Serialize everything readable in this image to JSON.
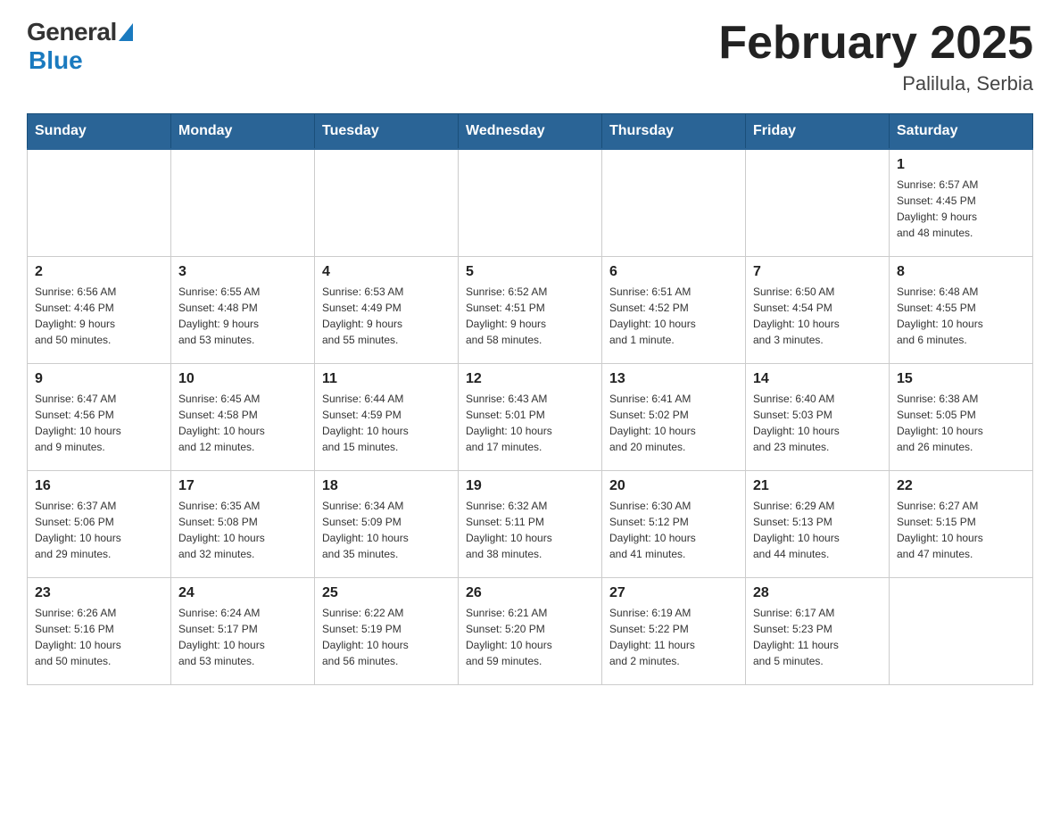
{
  "header": {
    "logo": {
      "general": "General",
      "blue": "Blue"
    },
    "title": "February 2025",
    "location": "Palilula, Serbia"
  },
  "weekdays": [
    "Sunday",
    "Monday",
    "Tuesday",
    "Wednesday",
    "Thursday",
    "Friday",
    "Saturday"
  ],
  "weeks": [
    [
      {
        "day": "",
        "info": ""
      },
      {
        "day": "",
        "info": ""
      },
      {
        "day": "",
        "info": ""
      },
      {
        "day": "",
        "info": ""
      },
      {
        "day": "",
        "info": ""
      },
      {
        "day": "",
        "info": ""
      },
      {
        "day": "1",
        "info": "Sunrise: 6:57 AM\nSunset: 4:45 PM\nDaylight: 9 hours\nand 48 minutes."
      }
    ],
    [
      {
        "day": "2",
        "info": "Sunrise: 6:56 AM\nSunset: 4:46 PM\nDaylight: 9 hours\nand 50 minutes."
      },
      {
        "day": "3",
        "info": "Sunrise: 6:55 AM\nSunset: 4:48 PM\nDaylight: 9 hours\nand 53 minutes."
      },
      {
        "day": "4",
        "info": "Sunrise: 6:53 AM\nSunset: 4:49 PM\nDaylight: 9 hours\nand 55 minutes."
      },
      {
        "day": "5",
        "info": "Sunrise: 6:52 AM\nSunset: 4:51 PM\nDaylight: 9 hours\nand 58 minutes."
      },
      {
        "day": "6",
        "info": "Sunrise: 6:51 AM\nSunset: 4:52 PM\nDaylight: 10 hours\nand 1 minute."
      },
      {
        "day": "7",
        "info": "Sunrise: 6:50 AM\nSunset: 4:54 PM\nDaylight: 10 hours\nand 3 minutes."
      },
      {
        "day": "8",
        "info": "Sunrise: 6:48 AM\nSunset: 4:55 PM\nDaylight: 10 hours\nand 6 minutes."
      }
    ],
    [
      {
        "day": "9",
        "info": "Sunrise: 6:47 AM\nSunset: 4:56 PM\nDaylight: 10 hours\nand 9 minutes."
      },
      {
        "day": "10",
        "info": "Sunrise: 6:45 AM\nSunset: 4:58 PM\nDaylight: 10 hours\nand 12 minutes."
      },
      {
        "day": "11",
        "info": "Sunrise: 6:44 AM\nSunset: 4:59 PM\nDaylight: 10 hours\nand 15 minutes."
      },
      {
        "day": "12",
        "info": "Sunrise: 6:43 AM\nSunset: 5:01 PM\nDaylight: 10 hours\nand 17 minutes."
      },
      {
        "day": "13",
        "info": "Sunrise: 6:41 AM\nSunset: 5:02 PM\nDaylight: 10 hours\nand 20 minutes."
      },
      {
        "day": "14",
        "info": "Sunrise: 6:40 AM\nSunset: 5:03 PM\nDaylight: 10 hours\nand 23 minutes."
      },
      {
        "day": "15",
        "info": "Sunrise: 6:38 AM\nSunset: 5:05 PM\nDaylight: 10 hours\nand 26 minutes."
      }
    ],
    [
      {
        "day": "16",
        "info": "Sunrise: 6:37 AM\nSunset: 5:06 PM\nDaylight: 10 hours\nand 29 minutes."
      },
      {
        "day": "17",
        "info": "Sunrise: 6:35 AM\nSunset: 5:08 PM\nDaylight: 10 hours\nand 32 minutes."
      },
      {
        "day": "18",
        "info": "Sunrise: 6:34 AM\nSunset: 5:09 PM\nDaylight: 10 hours\nand 35 minutes."
      },
      {
        "day": "19",
        "info": "Sunrise: 6:32 AM\nSunset: 5:11 PM\nDaylight: 10 hours\nand 38 minutes."
      },
      {
        "day": "20",
        "info": "Sunrise: 6:30 AM\nSunset: 5:12 PM\nDaylight: 10 hours\nand 41 minutes."
      },
      {
        "day": "21",
        "info": "Sunrise: 6:29 AM\nSunset: 5:13 PM\nDaylight: 10 hours\nand 44 minutes."
      },
      {
        "day": "22",
        "info": "Sunrise: 6:27 AM\nSunset: 5:15 PM\nDaylight: 10 hours\nand 47 minutes."
      }
    ],
    [
      {
        "day": "23",
        "info": "Sunrise: 6:26 AM\nSunset: 5:16 PM\nDaylight: 10 hours\nand 50 minutes."
      },
      {
        "day": "24",
        "info": "Sunrise: 6:24 AM\nSunset: 5:17 PM\nDaylight: 10 hours\nand 53 minutes."
      },
      {
        "day": "25",
        "info": "Sunrise: 6:22 AM\nSunset: 5:19 PM\nDaylight: 10 hours\nand 56 minutes."
      },
      {
        "day": "26",
        "info": "Sunrise: 6:21 AM\nSunset: 5:20 PM\nDaylight: 10 hours\nand 59 minutes."
      },
      {
        "day": "27",
        "info": "Sunrise: 6:19 AM\nSunset: 5:22 PM\nDaylight: 11 hours\nand 2 minutes."
      },
      {
        "day": "28",
        "info": "Sunrise: 6:17 AM\nSunset: 5:23 PM\nDaylight: 11 hours\nand 5 minutes."
      },
      {
        "day": "",
        "info": ""
      }
    ]
  ]
}
